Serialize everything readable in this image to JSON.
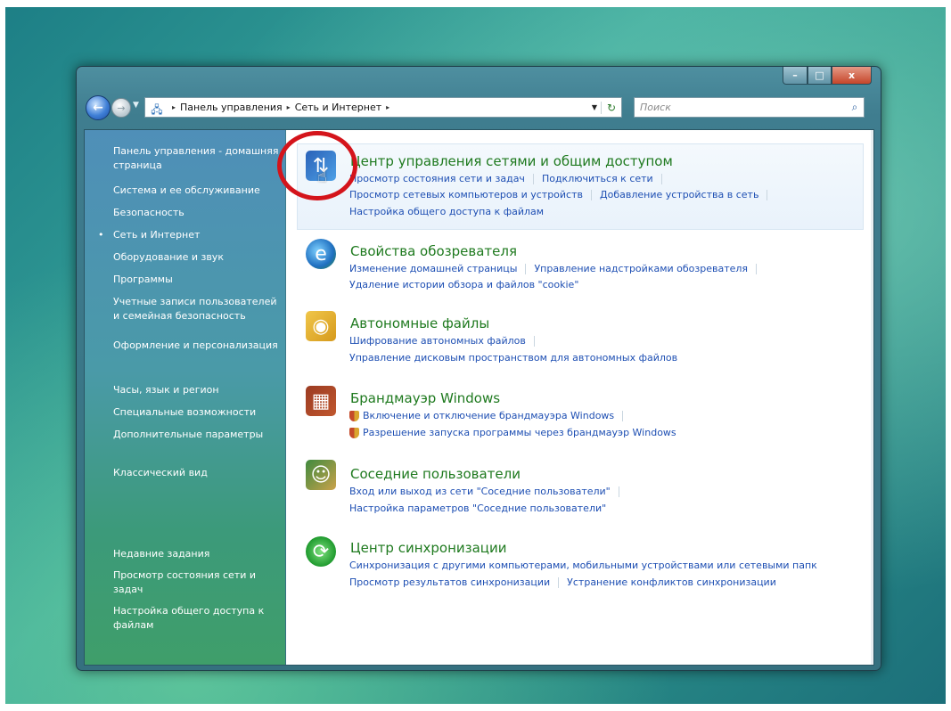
{
  "window": {
    "controls": {
      "minimize": "–",
      "maximize": "□",
      "close": "x"
    }
  },
  "address": {
    "breadcrumbs": [
      "Панель управления",
      "Сеть и Интернет"
    ],
    "separator": "▸",
    "search_placeholder": "Поиск"
  },
  "sidebar": {
    "items": [
      {
        "label": "Панель управления - домашняя страница"
      },
      {
        "label": "Система и ее обслуживание"
      },
      {
        "label": "Безопасность"
      },
      {
        "label": "Сеть и Интернет",
        "current": true
      },
      {
        "label": "Оборудование и звук"
      },
      {
        "label": "Программы"
      },
      {
        "label": "Учетные записи пользователей и семейная безопасность"
      },
      {
        "label": "Оформление и персонализация"
      },
      {
        "label": "Часы, язык и регион"
      },
      {
        "label": "Специальные возможности"
      },
      {
        "label": "Дополнительные параметры"
      }
    ],
    "classic_view": "Классический вид",
    "recent_tasks_title": "Недавние задания",
    "recent_tasks": [
      "Просмотр состояния сети и задач",
      "Настройка общего доступа к файлам"
    ]
  },
  "categories": [
    {
      "title": "Центр управления сетями и общим доступом",
      "icon": "network-center-icon",
      "links": [
        [
          "Просмотр состояния сети и задач",
          "Подключиться к сети"
        ],
        [
          "Просмотр сетевых компьютеров и устройств",
          "Добавление устройства в сеть"
        ],
        [
          "Настройка общего доступа к файлам"
        ]
      ]
    },
    {
      "title": "Свойства обозревателя",
      "icon": "internet-options-icon",
      "links": [
        [
          "Изменение домашней страницы",
          "Управление надстройками обозревателя"
        ],
        [
          "Удаление истории обзора и файлов \"cookie\""
        ]
      ]
    },
    {
      "title": "Автономные файлы",
      "icon": "offline-files-icon",
      "links": [
        [
          "Шифрование автономных файлов"
        ],
        [
          "Управление дисковым пространством для автономных файлов"
        ]
      ]
    },
    {
      "title": "Брандмауэр Windows",
      "icon": "firewall-icon",
      "links": [
        [
          "Включение и отключение брандмауэра Windows"
        ],
        [
          "Разрешение запуска программы через брандмауэр Windows"
        ]
      ]
    },
    {
      "title": "Соседние пользователи",
      "icon": "people-near-me-icon",
      "links": [
        [
          "Вход или выход из сети \"Соседние пользователи\""
        ],
        [
          "Настройка параметров \"Соседние пользователи\""
        ]
      ]
    },
    {
      "title": "Центр синхронизации",
      "icon": "sync-center-icon",
      "links": [
        [
          "Синхронизация с другими компьютерами, мобильными устройствами или сетевыми папк"
        ],
        [
          "Просмотр результатов синхронизации",
          "Устранение конфликтов синхронизации"
        ]
      ]
    }
  ],
  "colors": {
    "link": "#1e4fb3",
    "category_title": "#1f7a1f",
    "annotation_circle": "#d4141b"
  }
}
